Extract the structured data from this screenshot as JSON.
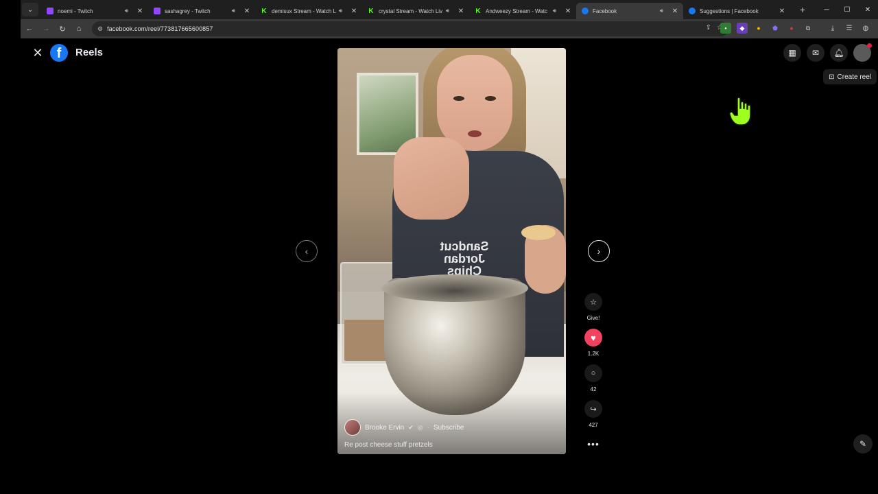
{
  "browser": {
    "tabs": [
      {
        "title": "noemi - Twitch",
        "favicon": "twitch-icon",
        "audio": true,
        "active": false
      },
      {
        "title": "sashagrey - Twitch",
        "favicon": "twitch-icon",
        "audio": true,
        "active": false
      },
      {
        "title": "demisux Stream - Watch Li",
        "favicon": "kick-icon",
        "audio": true,
        "active": false
      },
      {
        "title": "crystal Stream - Watch Liv",
        "favicon": "kick-icon",
        "audio": true,
        "active": false
      },
      {
        "title": "Andweezy Stream - Watc",
        "favicon": "kick-icon",
        "audio": true,
        "active": false
      },
      {
        "title": "Facebook",
        "favicon": "facebook-icon",
        "audio": true,
        "active": true
      },
      {
        "title": "Suggestions | Facebook",
        "favicon": "facebook-icon",
        "audio": false,
        "active": false
      }
    ],
    "url": "facebook.com/reel/773817665600857"
  },
  "header": {
    "title": "Reels",
    "logo_letter": "f",
    "create_reel_label": "Create reel"
  },
  "reel": {
    "author": "Brooke Ervin",
    "subscribe_label": "Subscribe",
    "caption": "Re post cheese stuff pretzels",
    "shirt_text": "Sandcut Jordan Chips"
  },
  "actions": {
    "give_label": "Give!",
    "likes": "1.2K",
    "comments": "42",
    "shares": "427"
  },
  "colors": {
    "facebook_blue": "#1877f2",
    "like_red": "#f3425f",
    "kick_green": "#53fc18",
    "twitch_purple": "#9146ff"
  }
}
